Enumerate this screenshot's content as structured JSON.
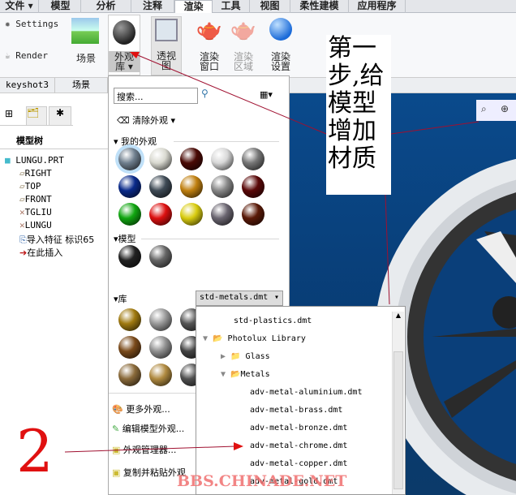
{
  "tabs": [
    "文件 ▾",
    "模型",
    "分析",
    "注释",
    "渲染",
    "工具",
    "视图",
    "柔性建模",
    "应用程序"
  ],
  "ribbon": {
    "settings": "Settings",
    "render": "Render",
    "scene": "场景",
    "appearance_lib": "外观\n库 ▾",
    "perspective": "透视\n图",
    "render_window": "渲染\n窗口",
    "render_region": "渲染\n区域",
    "render_setup": "渲染\n设置"
  },
  "groups": {
    "keyshot": "keyshot3",
    "scene": "场景"
  },
  "model_tree": {
    "title": "模型树",
    "items": [
      "LUNGU.PRT",
      "RIGHT",
      "TOP",
      "FRONT",
      "TGLIU",
      "LUNGU",
      "导入特征 标识65",
      "在此插入"
    ]
  },
  "panel": {
    "search_placeholder": "搜索...",
    "clear": "清除外观 ▾",
    "my_appearances": "我的外观",
    "model": "模型",
    "library": "库",
    "library_file": "std-metals.dmt",
    "my_colors": [
      "#6f7f8e",
      "#d9d9d0",
      "#4a0a05",
      "#d8d8d8",
      "#777",
      "#0a2a8a",
      "#3e4a55",
      "#c08010",
      "#888",
      "#5a0808",
      "#11a611",
      "#dd1010",
      "#d9cc10",
      "#6a6570",
      "#5a1a08"
    ],
    "model_colors": [
      "#222",
      "#666"
    ],
    "lib_colors": [
      "#a07a10",
      "#999",
      "#555",
      "#7a4a1a",
      "#909090",
      "#444",
      "#8a6a3a",
      "#b08a40",
      "#505050"
    ],
    "actions": [
      "更多外观...",
      "编辑模型外观...",
      "外观管理器...",
      "复制并粘贴外观"
    ]
  },
  "dropdown_list": {
    "items": [
      "std-plastics.dmt",
      "Photolux Library",
      "Glass",
      "Metals",
      "adv-metal-aluminium.dmt",
      "adv-metal-brass.dmt",
      "adv-metal-bronze.dmt",
      "adv-metal-chrome.dmt",
      "adv-metal-copper.dmt",
      "adv-metal-gold.dmt"
    ]
  },
  "annotation": {
    "step1": "第一步,给模型增加材质",
    "step2": "2"
  },
  "watermark": "BBS.CHINADE.NET"
}
